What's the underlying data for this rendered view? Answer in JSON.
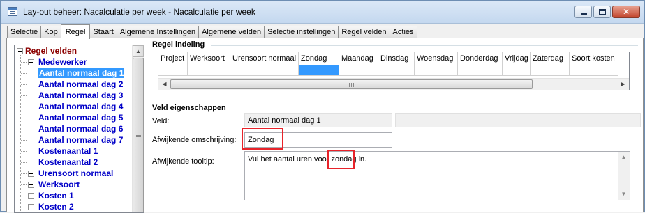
{
  "window": {
    "title": "Lay-out beheer: Nacalculatie per week - Nacalculatie per week",
    "minimize_glyph": "",
    "maximize_glyph": "",
    "close_glyph": "✕"
  },
  "tabs": [
    "Selectie",
    "Kop",
    "Regel",
    "Staart",
    "Algemene Instellingen",
    "Algemene velden",
    "Selectie instellingen",
    "Regel velden",
    "Acties"
  ],
  "active_tab": "Regel",
  "tree": {
    "root_label": "Regel velden",
    "items": [
      {
        "label": "Medewerker",
        "expandable": true,
        "selected": false
      },
      {
        "label": "Aantal normaal dag 1",
        "expandable": false,
        "selected": true
      },
      {
        "label": "Aantal normaal dag 2",
        "expandable": false,
        "selected": false
      },
      {
        "label": "Aantal normaal dag 3",
        "expandable": false,
        "selected": false
      },
      {
        "label": "Aantal normaal dag 4",
        "expandable": false,
        "selected": false
      },
      {
        "label": "Aantal normaal dag 5",
        "expandable": false,
        "selected": false
      },
      {
        "label": "Aantal normaal dag 6",
        "expandable": false,
        "selected": false
      },
      {
        "label": "Aantal normaal dag 7",
        "expandable": false,
        "selected": false
      },
      {
        "label": "Kostenaantal 1",
        "expandable": false,
        "selected": false
      },
      {
        "label": "Kostenaantal 2",
        "expandable": false,
        "selected": false
      },
      {
        "label": "Urensoort normaal",
        "expandable": true,
        "selected": false
      },
      {
        "label": "Werksoort",
        "expandable": true,
        "selected": false
      },
      {
        "label": "Kosten 1",
        "expandable": true,
        "selected": false
      },
      {
        "label": "Kosten 2",
        "expandable": true,
        "selected": false
      }
    ]
  },
  "regel_indeling": {
    "title": "Regel indeling",
    "columns": [
      "Project",
      "Werksoort",
      "Urensoort normaal",
      "Zondag",
      "Maandag",
      "Dinsdag",
      "Woensdag",
      "Donderdag",
      "Vrijdag",
      "Zaterdag",
      "Soort kosten"
    ],
    "selected_column": "Zondag",
    "scroll_grip": "|||"
  },
  "veld_eigenschappen": {
    "title": "Veld eigenschappen",
    "veld_label": "Veld:",
    "veld_value": "Aantal normaal dag 1",
    "veld_extra": "",
    "omschrijving_label": "Afwijkende omschrijving:",
    "omschrijving_value": "Zondag",
    "tooltip_label": "Afwijkende tooltip:",
    "tooltip_value": "Vul het aantal uren voor zondag in."
  },
  "colors": {
    "highlight": "#e8232a",
    "selection": "#3399ff",
    "tree_item": "#0000c8",
    "tree_root": "#8b0000"
  }
}
